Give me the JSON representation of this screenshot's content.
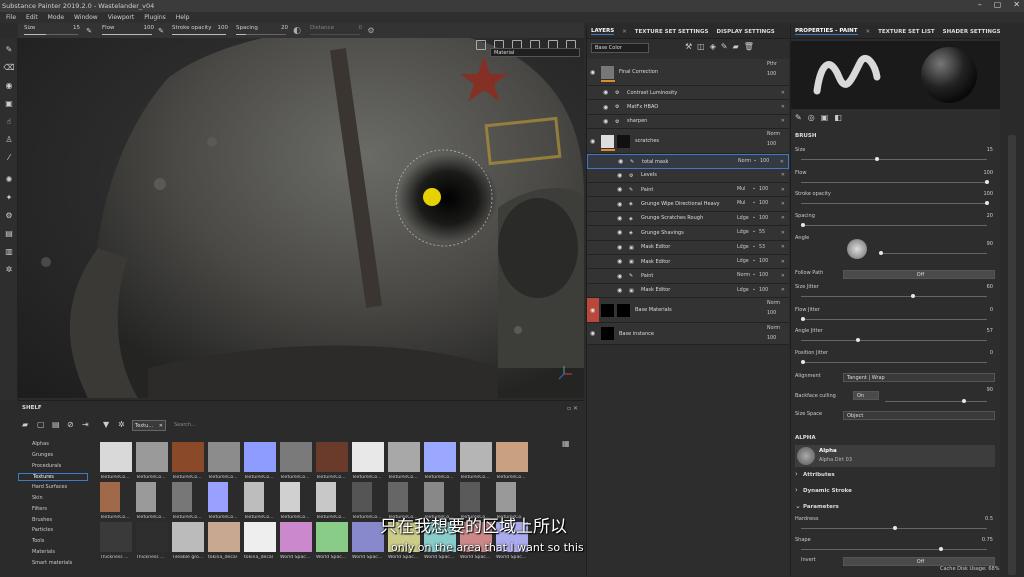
{
  "app": {
    "title": "Substance Painter 2019.2.0 - Wastelander_v04"
  },
  "window_controls": [
    "–",
    "▢",
    "✕"
  ],
  "menu": [
    "File",
    "Edit",
    "Mode",
    "Window",
    "Viewport",
    "Plugins",
    "Help"
  ],
  "tool_options": {
    "size": {
      "label": "Size",
      "value": "15",
      "fill": 0.4
    },
    "flow": {
      "label": "Flow",
      "value": "100",
      "fill": 1.0
    },
    "stroke_opacity": {
      "label": "Stroke opacity",
      "value": "100",
      "fill": 1.0
    },
    "spacing": {
      "label": "Spacing",
      "value": "20",
      "fill": 0.2
    },
    "distance": {
      "label": "Distance",
      "value": "0",
      "fill": 0.0
    }
  },
  "viewport": {
    "material_select": "Material"
  },
  "shelf": {
    "header": "SHELF",
    "tab_label": "Textu…",
    "search_placeholder": "Search...",
    "categories": [
      "Alphas",
      "Grunges",
      "Procedurals",
      "Textures",
      "Hard Surfaces",
      "Skin",
      "Filters",
      "Brushes",
      "Particles",
      "Tools",
      "Materials",
      "Smart materials"
    ],
    "selected_category": "Textures",
    "thumbs_row1": [
      {
        "label": "TexturesCo...",
        "color": "#d9d9d9"
      },
      {
        "label": "TexturesCo...",
        "color": "#9a9a9a"
      },
      {
        "label": "TexturesCo...",
        "color": "#8a4a2a"
      },
      {
        "label": "TexturesCo...",
        "color": "#8c8c8c"
      },
      {
        "label": "TexturesCo...",
        "color": "#8f9cff"
      },
      {
        "label": "TexturesCo...",
        "color": "#7a7a7a"
      },
      {
        "label": "TexturesCo...",
        "color": "#6a3a2a"
      },
      {
        "label": "TexturesCo...",
        "color": "#e8e8e8"
      },
      {
        "label": "TexturesCo...",
        "color": "#a8a8a8"
      },
      {
        "label": "TexturesCo...",
        "color": "#9aa8ff"
      },
      {
        "label": "TexturesCo...",
        "color": "#b5b5b5"
      },
      {
        "label": "TexturesCo...",
        "color": "#c9a080"
      }
    ],
    "thumbs_row2": [
      {
        "label": "TexturesCo...",
        "color": "#a06a4a"
      },
      {
        "label": "TexturesCo...",
        "color": "#9a9a9a"
      },
      {
        "label": "TexturesCo...",
        "color": "#777777"
      },
      {
        "label": "TexturesCo...",
        "color": "#9aa0ff"
      },
      {
        "label": "TexturesCo...",
        "color": "#bdbdbd"
      },
      {
        "label": "TexturesCo...",
        "color": "#d0d0d0"
      },
      {
        "label": "TexturesCo...",
        "color": "#c8c8c8"
      },
      {
        "label": "TexturesCo...",
        "color": "#555555"
      },
      {
        "label": "TexturesCo...",
        "color": "#666666"
      },
      {
        "label": "TexturesCo...",
        "color": "#888888"
      },
      {
        "label": "TexturesCo...",
        "color": "#5a5a5a"
      },
      {
        "label": "TexturesCo...",
        "color": "#999999"
      }
    ],
    "thumbs_row3": [
      {
        "label": "Thickness ...",
        "color": "#3a3a3a"
      },
      {
        "label": "Thickness ...",
        "color": "#2e2e2e"
      },
      {
        "label": "Tileable gro...",
        "color": "#bbbbbb"
      },
      {
        "label": "tokina_decal",
        "color": "#c8a890"
      },
      {
        "label": "tokina_decal",
        "color": "#eeeeee"
      },
      {
        "label": "World Spac...",
        "color": "#cc88cc"
      },
      {
        "label": "World Spac...",
        "color": "#88cc88"
      },
      {
        "label": "World Spac...",
        "color": "#8888cc"
      },
      {
        "label": "World Spac...",
        "color": "#cccc88"
      },
      {
        "label": "World Spac...",
        "color": "#88cccc"
      },
      {
        "label": "World Spac...",
        "color": "#cc8888"
      },
      {
        "label": "World Spac...",
        "color": "#aaaaee"
      }
    ]
  },
  "layers": {
    "tabs": [
      "LAYERS",
      "TEXTURE SET SETTINGS",
      "DISPLAY SETTINGS"
    ],
    "channel": "Base Color",
    "items": [
      {
        "name": "Final Correction",
        "blend": "Pthr",
        "opacity": "100",
        "type": "group",
        "indent": 0
      },
      {
        "name": "Contrast Luminosity",
        "blend": "",
        "opacity": "",
        "type": "filter",
        "indent": 1
      },
      {
        "name": "MatFx HBAO",
        "blend": "",
        "opacity": "",
        "type": "filter",
        "indent": 1
      },
      {
        "name": "sharpen",
        "blend": "",
        "opacity": "",
        "type": "filter",
        "indent": 1
      },
      {
        "name": "scratches",
        "blend": "Norm",
        "opacity": "100",
        "type": "group",
        "indent": 0
      },
      {
        "name": "total mask",
        "blend": "Norm",
        "opacity": "100",
        "type": "paint",
        "indent": 2
      },
      {
        "name": "Levels",
        "blend": "",
        "opacity": "",
        "type": "filter",
        "indent": 2
      },
      {
        "name": "Paint",
        "blend": "Mul",
        "opacity": "100",
        "type": "paint",
        "indent": 2
      },
      {
        "name": "Grunge Wipe Directional Heavy",
        "blend": "Mul",
        "opacity": "100",
        "type": "fill",
        "indent": 2
      },
      {
        "name": "Grunge Scratches Rough",
        "blend": "Ldge",
        "opacity": "100",
        "type": "fill",
        "indent": 2
      },
      {
        "name": "Grunge Shavings",
        "blend": "Ldge",
        "opacity": "55",
        "type": "fill",
        "indent": 2
      },
      {
        "name": "Mask Editor",
        "blend": "Ldge",
        "opacity": "53",
        "type": "gen",
        "indent": 2
      },
      {
        "name": "Mask Editor",
        "blend": "Ldge",
        "opacity": "100",
        "type": "gen",
        "indent": 2
      },
      {
        "name": "Paint",
        "blend": "Norm",
        "opacity": "100",
        "type": "paint",
        "indent": 2
      },
      {
        "name": "Mask Editor",
        "blend": "Ldge",
        "opacity": "100",
        "type": "gen",
        "indent": 2
      },
      {
        "name": "Base Materials",
        "blend": "Norm",
        "opacity": "100",
        "type": "group",
        "indent": 0
      },
      {
        "name": "Base instance",
        "blend": "Norm",
        "opacity": "100",
        "type": "instance",
        "indent": 0
      }
    ],
    "sub_opacity": [
      "100",
      "100"
    ]
  },
  "properties": {
    "tabs": [
      "PROPERTIES - PAINT",
      "TEXTURE SET LIST",
      "SHADER SETTINGS"
    ],
    "brush_section": "BRUSH",
    "size": {
      "label": "Size",
      "value": "15",
      "pct": 0.4
    },
    "flow": {
      "label": "Flow",
      "value": "100",
      "pct": 1.0
    },
    "stroke_opacity": {
      "label": "Stroke opacity",
      "value": "100",
      "pct": 1.0
    },
    "spacing": {
      "label": "Spacing",
      "value": "20",
      "pct": 0.0
    },
    "angle": {
      "label": "Angle",
      "value": "90",
      "pct": 0.0
    },
    "follow_path": {
      "label": "Follow Path",
      "value": "Off"
    },
    "size_jitter": {
      "label": "Size Jitter",
      "value": "60",
      "pct": 0.6
    },
    "flow_jitter": {
      "label": "Flow Jitter",
      "value": "0",
      "pct": 0.0
    },
    "angle_jitter": {
      "label": "Angle Jitter",
      "value": "57",
      "pct": 0.3
    },
    "position_jitter": {
      "label": "Position Jitter",
      "value": "0",
      "pct": 0.0
    },
    "alignment": {
      "label": "Alignment",
      "value": "Tangent | Wrap"
    },
    "backface_culling": {
      "label": "Backface culling",
      "toggle": "On",
      "value": "90",
      "pct": 0.75
    },
    "size_space": {
      "label": "Size Space",
      "value": "Object"
    },
    "alpha_section": "ALPHA",
    "alpha_name": "Alpha",
    "alpha_sub": "Alpha Dirt 03",
    "attributes": "Attributes",
    "dynamic_stroke": "Dynamic Stroke",
    "parameters": "Parameters",
    "hardness": {
      "label": "Hardness",
      "value": "0.5",
      "pct": 0.5
    },
    "shape": {
      "label": "Shape",
      "value": "0.75",
      "pct": 0.75
    },
    "invert": {
      "label": "Invert",
      "value": "Off"
    }
  },
  "status": {
    "text": "Cache Disk Usage:",
    "value": "68%"
  },
  "subtitles": {
    "cn": "只在我想要的区域上所以",
    "en": "only on the area that I want so this"
  },
  "colors": {
    "accent": "#3d7bc9",
    "orange": "#e08a2c",
    "selected_red": "#b8493a",
    "brush_cursor": "#e6d200"
  }
}
